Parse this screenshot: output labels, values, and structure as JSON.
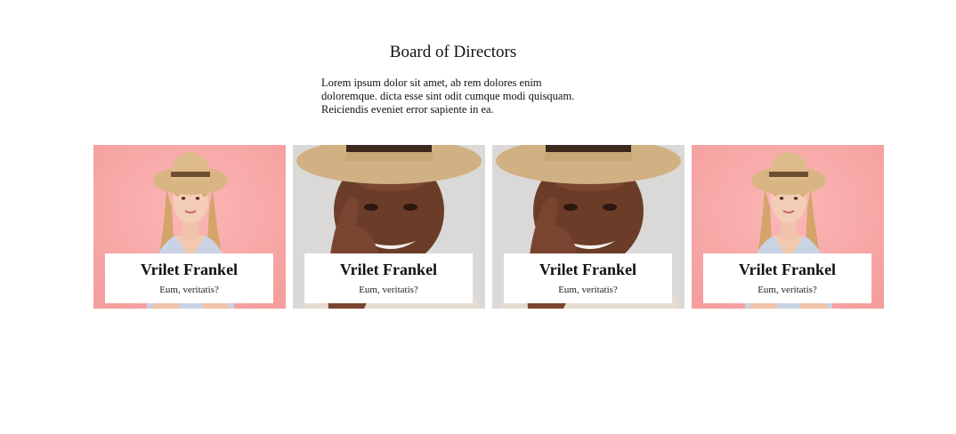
{
  "section": {
    "title": "Board of Directors",
    "intro": "Lorem ipsum dolor sit amet, ab rem dolores enim doloremque. dicta esse sint odit cumque modi quisquam. Reiciendis eveniet error sapiente in ea."
  },
  "cards": [
    {
      "photo": "woman-in-hat-photo",
      "name": "Vrilet Frankel",
      "role": "Eum, veritatis?"
    },
    {
      "photo": "smiling-man-in-hat-photo",
      "name": "Vrilet Frankel",
      "role": "Eum, veritatis?"
    },
    {
      "photo": "smiling-man-in-hat-photo",
      "name": "Vrilet Frankel",
      "role": "Eum, veritatis?"
    },
    {
      "photo": "woman-in-hat-photo",
      "name": "Vrilet Frankel",
      "role": "Eum, veritatis?"
    }
  ],
  "colors": {
    "pink_background": "#f6a9a8",
    "grey_background": "#d9d8d6",
    "caption_background": "#ffffff"
  }
}
